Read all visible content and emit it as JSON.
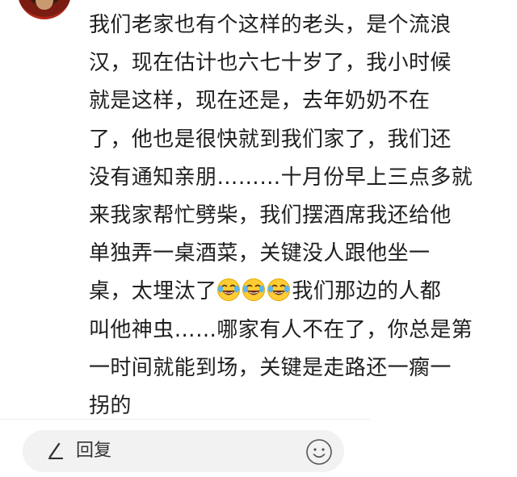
{
  "user": {
    "avatar_icon": "user-avatar"
  },
  "comment": {
    "lines": [
      {
        "text": "我们老家也有个这样的老头，是个流浪"
      },
      {
        "text": "汉，现在估计也六七十岁了，我小时候"
      },
      {
        "text": "就是这样，现在还是，去年奶奶不在"
      },
      {
        "text": "了，他也是很快就到我们家了，我们还"
      },
      {
        "text": "没有通知亲朋………十月份早上三点多就"
      },
      {
        "text": "来我家帮忙劈柴，我们摆酒席我还给他"
      },
      {
        "text": "单独弄一桌酒菜，关键没人跟他坐一"
      },
      {
        "text_before": "桌，太埋汰了",
        "emoji": "face-with-tears-of-joy-icon",
        "emoji_count": 3,
        "text_after": "我们那边的人都"
      },
      {
        "text": "叫他神虫……哪家有人不在了，你总是第"
      },
      {
        "text": "一时间就能到场，关键是走路还一瘸一"
      },
      {
        "text": "拐的"
      }
    ]
  },
  "reply_bar": {
    "label": "回复",
    "pen_icon": "pen-icon",
    "emoji_icon": "smiley-face-icon"
  },
  "colors": {
    "text": "#1f1f1f",
    "reply_bg": "#f2f2f2",
    "emoji_yellow": "#ffcc33"
  }
}
